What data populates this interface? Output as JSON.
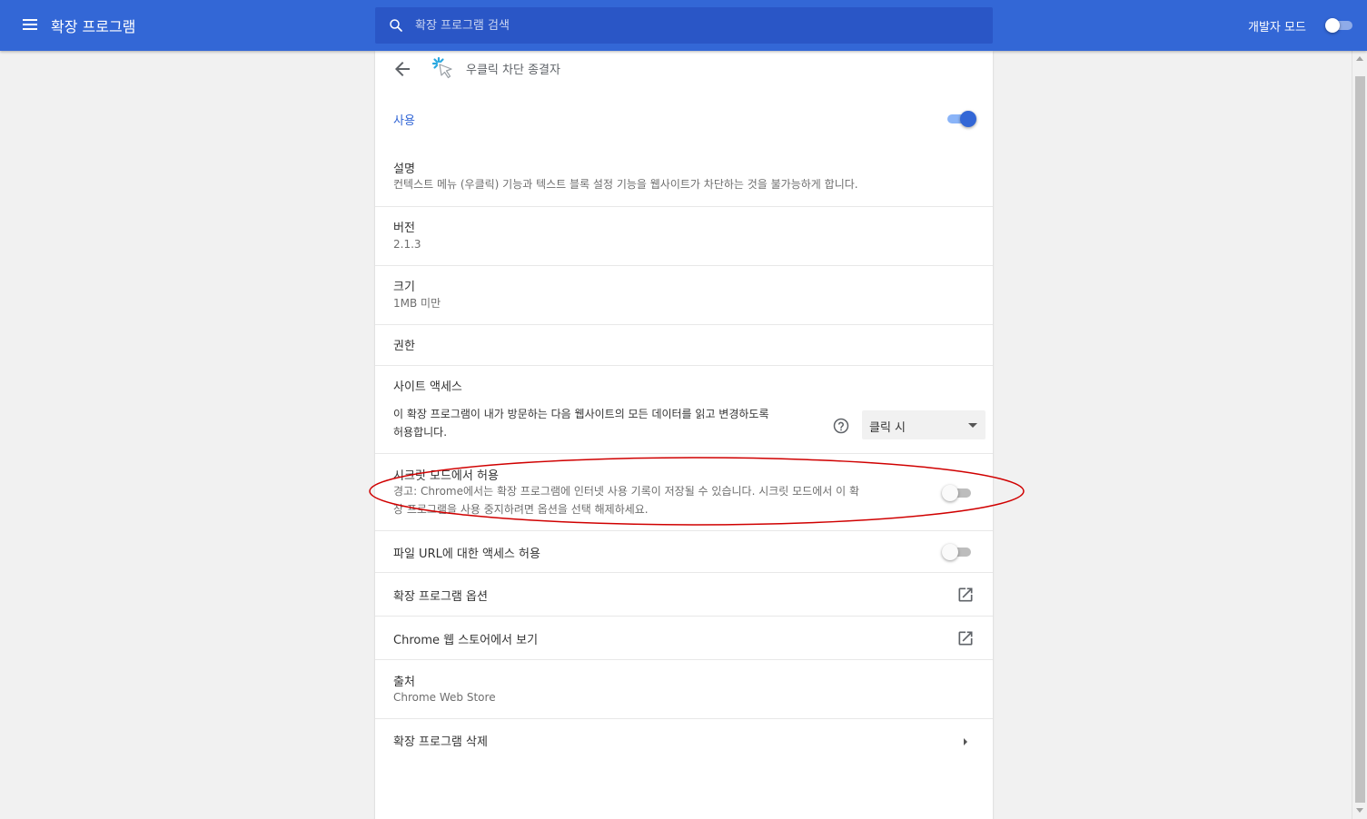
{
  "toolbar": {
    "title": "확장 프로그램",
    "search_placeholder": "확장 프로그램 검색",
    "developer_mode_label": "개발자 모드",
    "developer_mode_on": false,
    "accent_color": "#3367d6"
  },
  "extension": {
    "name": "우클릭 차단 종결자",
    "enabled_label": "사용",
    "enabled": true
  },
  "details": {
    "description_label": "설명",
    "description_value": "컨텍스트 메뉴 (우클릭) 기능과 텍스트 블록 설정 기능을 웹사이트가 차단하는 것을 불가능하게 합니다.",
    "version_label": "버전",
    "version_value": "2.1.3",
    "size_label": "크기",
    "size_value": "1MB 미만",
    "permissions_label": "권한",
    "site_access_label": "사이트 액세스",
    "site_access_desc_line1": "이 확장 프로그램이 내가 방문하는 다음 웹사이트의 모든 데이터를 읽고 변경하도록",
    "site_access_desc_line2": "허용합니다.",
    "site_access_selected": "클릭 시",
    "incognito_label": "시크릿 모드에서 허용",
    "incognito_warning_line1": "경고: Chrome에서는 확장 프로그램에 인터넷 사용 기록이 저장될 수 있습니다. 시크릿 모드에서 이 확",
    "incognito_warning_line2": "장 프로그램을 사용 중지하려면 옵션을 선택 해제하세요.",
    "incognito_allowed": false,
    "file_url_label": "파일 URL에 대한 액세스 허용",
    "file_url_allowed": false,
    "options_label": "확장 프로그램 옵션",
    "webstore_label": "Chrome 웹 스토어에서 보기",
    "source_label": "출처",
    "source_value": "Chrome Web Store",
    "remove_label": "확장 프로그램 삭제"
  },
  "icons": {
    "menu": "hamburger-icon",
    "search": "search-icon",
    "back": "back-arrow-icon",
    "help": "help-icon",
    "open_in_new": "open-in-new-icon",
    "chevron": "chevron-right-icon"
  },
  "annotation": {
    "color": "#d00000"
  }
}
